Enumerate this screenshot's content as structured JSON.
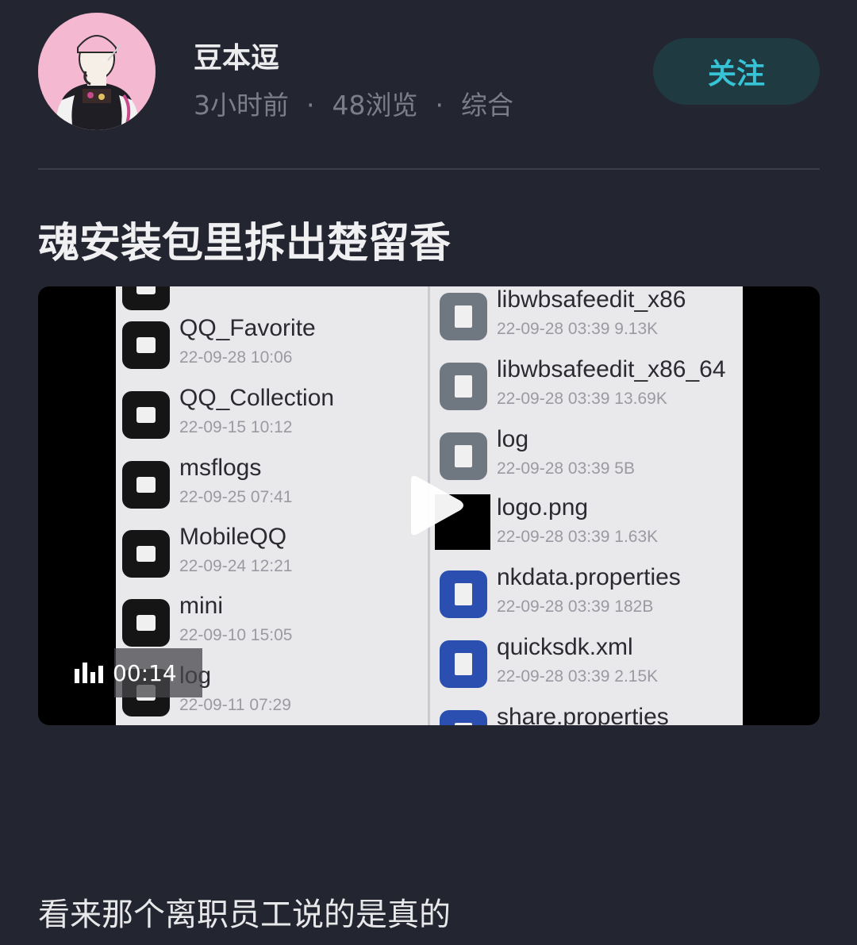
{
  "author": {
    "name": "豆本逗",
    "avatar_icon": "avatar-illustration"
  },
  "meta": {
    "time": "3小时前",
    "separator": "·",
    "views": "48浏览",
    "category": "综合"
  },
  "follow_button": {
    "label": "关注",
    "color": "#36c3d6"
  },
  "post": {
    "title": "魂安装包里拆出楚留香",
    "body": "看来那个离职员工说的是真的"
  },
  "video": {
    "duration": "00:14",
    "play_icon": "play-icon",
    "stats_icon": "bar-chart-icon",
    "left_files": [
      {
        "name": "QQ_Favorite",
        "sub": "22-09-28 10:06"
      },
      {
        "name": "QQ_Collection",
        "sub": "22-09-15 10:12"
      },
      {
        "name": "msflogs",
        "sub": "22-09-25 07:41"
      },
      {
        "name": "MobileQQ",
        "sub": "22-09-24 12:21"
      },
      {
        "name": "mini",
        "sub": "22-09-10 15:05"
      },
      {
        "name": "log",
        "sub": "22-09-11 07:29"
      }
    ],
    "right_files": [
      {
        "name": "libwbsafeedit_x86",
        "sub": "22-09-28 03:39  9.13K"
      },
      {
        "name": "libwbsafeedit_x86_64",
        "sub": "22-09-28 03:39  13.69K"
      },
      {
        "name": "log",
        "sub": "22-09-28 03:39  5B"
      },
      {
        "name": "logo.png",
        "sub": "22-09-28 03:39  1.63K"
      },
      {
        "name": "nkdata.properties",
        "sub": "22-09-28 03:39  182B"
      },
      {
        "name": "quicksdk.xml",
        "sub": "22-09-28 03:39  2.15K"
      },
      {
        "name": "share.properties",
        "sub": ""
      }
    ]
  }
}
